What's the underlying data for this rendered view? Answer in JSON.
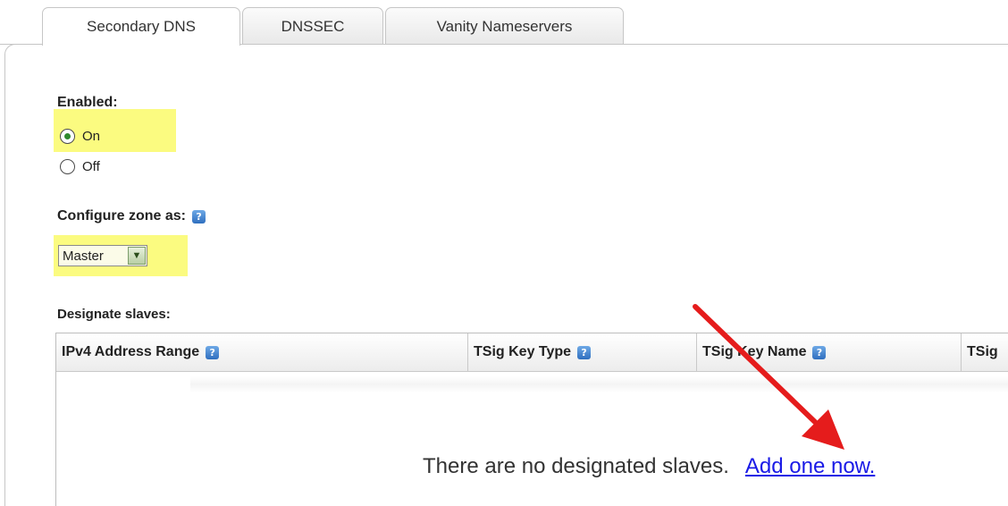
{
  "tabs": [
    {
      "label": "Secondary DNS",
      "active": true
    },
    {
      "label": "DNSSEC",
      "active": false
    },
    {
      "label": "Vanity Nameservers",
      "active": false
    }
  ],
  "enabled": {
    "label": "Enabled:",
    "options": [
      {
        "label": "On",
        "checked": true
      },
      {
        "label": "Off",
        "checked": false
      }
    ]
  },
  "configure": {
    "label": "Configure zone as:",
    "selected": "Master"
  },
  "slaves": {
    "label": "Designate slaves:",
    "columns": [
      "IPv4 Address Range",
      "TSig Key Type",
      "TSig Key Name",
      "TSig"
    ],
    "empty_text": "There are no designated slaves.",
    "add_link": "Add one now."
  },
  "colors": {
    "highlight": "#fbfb80",
    "link": "#1a1ae6",
    "arrow": "#e51c1c"
  }
}
